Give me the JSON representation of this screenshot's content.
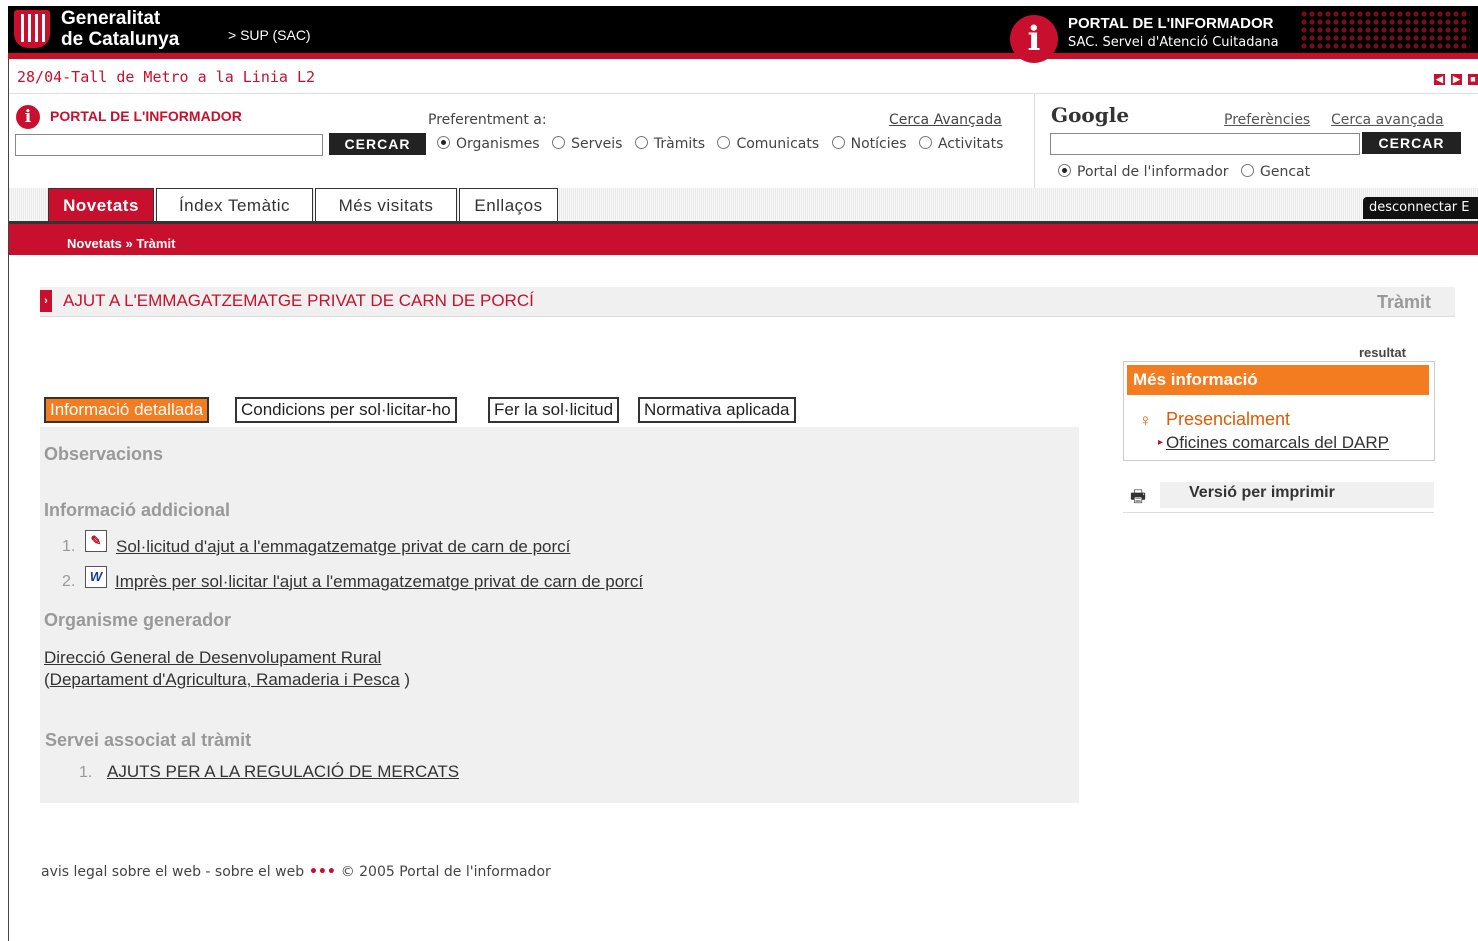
{
  "header": {
    "logo_line1": "Generalitat",
    "logo_line2": "de Catalunya",
    "sup": "> SUP (SAC)",
    "portal_title": "PORTAL DE L'INFORMADOR",
    "portal_subtitle": "SAC. Servei d'Atenció Cuitadana",
    "info_glyph": "i"
  },
  "news": {
    "text": "28/04-Tall de Metro a la Linia L2"
  },
  "search": {
    "portal_label": "PORTAL DE L'INFORMADOR",
    "pref_label": "Preferentment a:",
    "advanced": "Cerca Avançada",
    "button": "CERCAR",
    "value": "",
    "options": [
      "Organismes",
      "Serveis",
      "Tràmits",
      "Comunicats",
      "Notícies",
      "Activitats"
    ],
    "selected": "Organismes"
  },
  "google": {
    "label": "Google",
    "preferences": "Preferències",
    "advanced": "Cerca avançada",
    "button": "CERCAR",
    "value": "",
    "options": [
      "Portal de l'informador",
      "Gencat"
    ],
    "selected": "Portal de l'informador"
  },
  "tabs": [
    {
      "label": "Novetats",
      "active": true
    },
    {
      "label": "Índex Temàtic",
      "active": false
    },
    {
      "label": "Més visitats",
      "active": false
    },
    {
      "label": "Enllaços",
      "active": false
    }
  ],
  "disconnect": "desconnectar E",
  "breadcrumb": {
    "link": "Novetats",
    "sep": " » ",
    "current": "Tràmit"
  },
  "title": {
    "text": "AJUT A L'EMMAGATZEMATGE PRIVAT DE CARN DE PORCÍ",
    "type": "Tràmit"
  },
  "content_tabs": [
    {
      "label": "Informació detallada",
      "active": true
    },
    {
      "label": "Condicions per sol·licitar-ho",
      "active": false
    },
    {
      "label": "Fer la sol·licitud",
      "active": false
    },
    {
      "label": "Normativa aplicada",
      "active": false
    }
  ],
  "content": {
    "observacions": "Observacions",
    "info_addicional": "Informació addicional",
    "docs": [
      {
        "num": "1.",
        "text": "Sol·licitud d'ajut a l'emmagatzematge privat de carn de porcí",
        "icon": "pdf-icon"
      },
      {
        "num": "2.",
        "text": "Imprès per sol·licitar l'ajut a l'emmagatzematge privat de carn de porcí",
        "icon": "word-icon"
      }
    ],
    "organisme_head": "Organisme generador",
    "organisme_name": "Direcció General de Desenvolupament Rural",
    "organisme_dept_open": "(",
    "organisme_dept": "Departament d'Agricultura, Ramaderia i Pesca",
    "organisme_dept_close": " )",
    "servei_head": "Servei associat al tràmit",
    "servei_num": "1.",
    "servei_link": "AJUTS PER A LA REGULACIÓ DE MERCATS"
  },
  "sidebar": {
    "resultat": "resultat",
    "mes_info": "Més informació",
    "presencialment": "Presencialment",
    "oficines": "Oficines comarcals del DARP",
    "print": "Versió per imprimir"
  },
  "footer": {
    "avis": "avis legal sobre el web",
    "dash": " - ",
    "sobre": "sobre el web",
    "dots": " ••• ",
    "copy": "© 2005 Portal de l'informador"
  },
  "colors": {
    "brand_red": "#c8102e",
    "accent_orange": "#f47c20"
  }
}
